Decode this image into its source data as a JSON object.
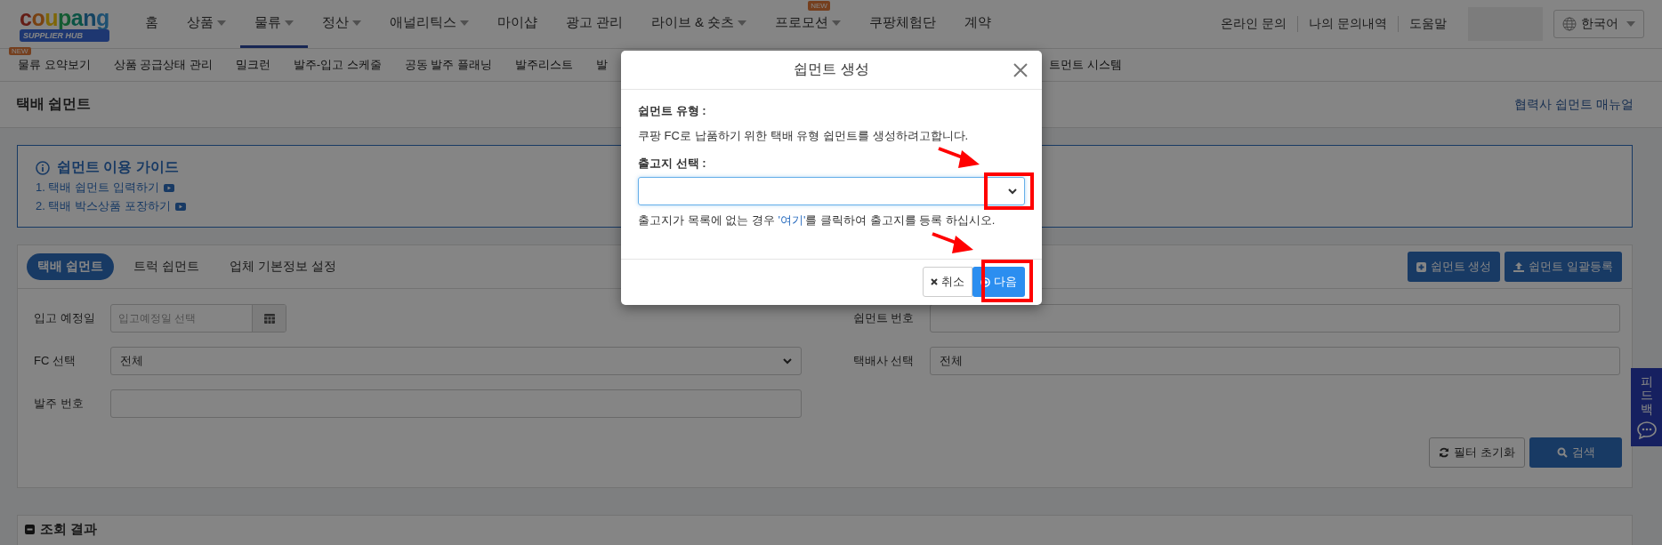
{
  "logo": {
    "word": "coupang",
    "badge": "SUPPLIER HUB"
  },
  "nav": [
    {
      "label": "홈",
      "has_menu": false,
      "selected": false
    },
    {
      "label": "상품",
      "has_menu": true,
      "selected": false
    },
    {
      "label": "물류",
      "has_menu": true,
      "selected": true
    },
    {
      "label": "정산",
      "has_menu": true,
      "selected": false
    },
    {
      "label": "애널리틱스",
      "has_menu": true,
      "selected": false
    },
    {
      "label": "마이샵",
      "has_menu": false,
      "selected": false
    },
    {
      "label": "광고 관리",
      "has_menu": false,
      "selected": false
    },
    {
      "label": "라이브 & 숏츠",
      "has_menu": true,
      "selected": false
    },
    {
      "label": "프로모션",
      "has_menu": true,
      "selected": false,
      "badge": "NEW"
    },
    {
      "label": "쿠팡체험단",
      "has_menu": false,
      "selected": false
    },
    {
      "label": "계약",
      "has_menu": false,
      "selected": false
    }
  ],
  "utility_links": [
    "온라인 문의",
    "나의 문의내역",
    "도움말"
  ],
  "language": "한국어",
  "subnav": {
    "items": [
      {
        "label": "물류 요약보기",
        "badge": "NEW"
      },
      {
        "label": "상품 공급상태 관리"
      },
      {
        "label": "밀크런"
      },
      {
        "label": "발주-입고 스케줄"
      },
      {
        "label": "공동 발주 플래닝"
      },
      {
        "label": "발주리스트"
      },
      {
        "label": "발"
      }
    ],
    "items_after_dialog": [
      {
        "label": "트먼트 시스템"
      }
    ]
  },
  "page": {
    "title": "택배 쉽먼트",
    "manual_link": "협력사 쉽먼트 매뉴얼"
  },
  "guide": {
    "title": "쉽먼트 이용 가이드",
    "items": [
      "1. 택배 쉽먼트 입력하기",
      "2. 택배 박스상품 포장하기"
    ]
  },
  "tabs": [
    {
      "label": "택배 쉽먼트",
      "selected": true
    },
    {
      "label": "트럭 쉽먼트",
      "selected": false
    },
    {
      "label": "업체 기본정보 설정",
      "selected": false
    }
  ],
  "actions": [
    {
      "label": "쉽먼트 생성",
      "kind": "plus"
    },
    {
      "label": "쉽먼트 일괄등록",
      "kind": "upload"
    }
  ],
  "filters": [
    {
      "label": "입고 예정일",
      "kind": "date",
      "placeholder": "입고예정일 선택"
    },
    {
      "label": "쉽먼트 번호",
      "kind": "text"
    },
    {
      "label": "FC 선택",
      "kind": "select",
      "value": "전체"
    },
    {
      "label": "택배사 선택",
      "kind": "text",
      "value": "전체"
    },
    {
      "label": "발주 번호",
      "kind": "text"
    }
  ],
  "filter_buttons": [
    {
      "label": "필터 초기화",
      "kind": "reset"
    },
    {
      "label": "검색",
      "kind": "search"
    }
  ],
  "results": {
    "title": "조회 결과"
  },
  "feedback": {
    "label": "피드백"
  },
  "dialog": {
    "title": "쉽먼트 생성",
    "type_label": "쉽먼트 유형 :",
    "description": "쿠팡 FC로 납품하기 위한 택배 유형 쉽먼트를 생성하려고합니다.",
    "origin_label": "출고지 선택 :",
    "hint": {
      "before": "출고지가 목록에 없는 경우 ",
      "link": "'여기'",
      "after": "를 클릭하여 출고지를 등록 하십시오."
    },
    "buttons": [
      {
        "label": "취소",
        "kind": "cancel"
      },
      {
        "label": "다음",
        "kind": "primary"
      }
    ]
  }
}
